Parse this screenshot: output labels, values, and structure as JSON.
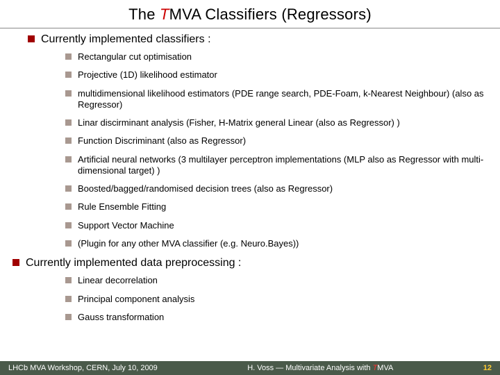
{
  "title_prefix": "The ",
  "title_t": "T",
  "title_rest": "MVA Classifiers  (Regressors)",
  "section1": "Currently implemented classifiers :",
  "items1": [
    "Rectangular cut optimisation",
    "Projective (1D) likelihood estimator",
    "multidimensional likelihood estimators (PDE range search, PDE-Foam, k-Nearest Neighbour)  (also as Regressor)",
    "Linar discirminant analysis (Fisher, H-Matrix general Linear (also as Regressor) )",
    "Function Discriminant (also as Regressor)",
    "Artificial neural networks (3 multilayer perceptron implementations (MLP also as Regressor with multi-dimensional target) )",
    "Boosted/bagged/randomised decision trees (also as Regressor)",
    "Rule Ensemble Fitting",
    "Support Vector Machine",
    "(Plugin for any other MVA classifier (e.g. Neuro.Bayes))"
  ],
  "section2": "Currently implemented data preprocessing :",
  "items2": [
    "Linear decorrelation",
    "Principal component analysis",
    "Gauss transformation"
  ],
  "footer": {
    "left": "LHCb MVA Workshop, CERN, July 10, 2009",
    "center_pre": "H. Voss ― Multivariate Analysis with ",
    "center_t": "T",
    "center_post": "MVA",
    "page": "12"
  }
}
